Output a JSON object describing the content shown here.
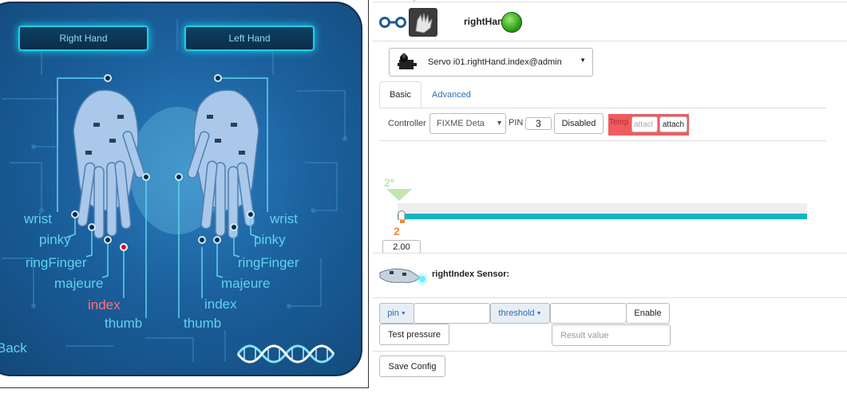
{
  "hand_panel": {
    "right_hand_btn": "Right Hand",
    "left_hand_btn": "Left Hand",
    "right_labels": [
      "wrist",
      "pinky",
      "ringFinger",
      "majeure",
      "index",
      "thumb"
    ],
    "left_labels": [
      "wrist",
      "pinky",
      "ringFinger",
      "majeure",
      "index",
      "thumb"
    ],
    "selected_finger": "index",
    "back_label": "Back"
  },
  "header": {
    "title": "rightHand is:",
    "status_color": "#2fa21c",
    "link_icon": "link-icon",
    "hand_icon": "hand-thumbnail-icon"
  },
  "servo_select": {
    "value": "Servo  i01.rightHand.index@admin"
  },
  "tabs": [
    "Basic",
    "Advanced"
  ],
  "controls": {
    "controller_label": "Controller",
    "controller_value": "FIXME Deta",
    "pin_label": "PIN",
    "pin_value": "3",
    "disabled_btn": "Disabled",
    "temp_label": "Temp",
    "attach_placeholder": "attacl",
    "attach_btn": "attach"
  },
  "slider": {
    "degree_marker": "2º",
    "value_label": "2",
    "input_value": "2.00",
    "position_fraction": 0.0,
    "accent": "#14b5c3"
  },
  "sensor": {
    "title": "rightIndex Sensor:",
    "pin_dropdown": "pin",
    "threshold_dropdown": "threshold",
    "enable_btn": "Enable",
    "test_btn": "Test pressure",
    "result_placeholder": "Result value"
  },
  "footer": {
    "save_btn": "Save Config"
  }
}
